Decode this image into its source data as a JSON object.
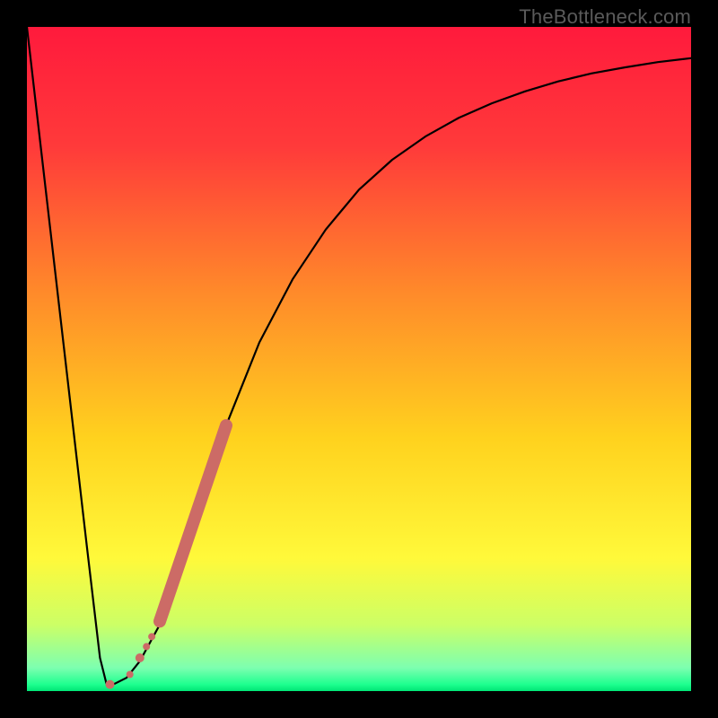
{
  "watermark": "TheBottleneck.com",
  "chart_data": {
    "type": "line",
    "title": "",
    "xlabel": "",
    "ylabel": "",
    "xlim": [
      0,
      100
    ],
    "ylim": [
      0,
      100
    ],
    "gradient_stops": [
      {
        "pos": 0.0,
        "color": "#ff1a3c"
      },
      {
        "pos": 0.18,
        "color": "#ff3a3a"
      },
      {
        "pos": 0.4,
        "color": "#ff8a2a"
      },
      {
        "pos": 0.62,
        "color": "#ffd21e"
      },
      {
        "pos": 0.8,
        "color": "#fff93a"
      },
      {
        "pos": 0.9,
        "color": "#ccff66"
      },
      {
        "pos": 0.965,
        "color": "#7dffb0"
      },
      {
        "pos": 0.99,
        "color": "#1eff8f"
      },
      {
        "pos": 1.0,
        "color": "#00e676"
      }
    ],
    "series": [
      {
        "name": "bottleneck-curve",
        "x": [
          0.0,
          3.0,
          6.0,
          9.0,
          11.0,
          12.0,
          13.0,
          15.0,
          17.0,
          20.0,
          22.0,
          24.0,
          27.0,
          30.0,
          35.0,
          40.0,
          45.0,
          50.0,
          55.0,
          60.0,
          65.0,
          70.0,
          75.0,
          80.0,
          85.0,
          90.0,
          95.0,
          100.0
        ],
        "values": [
          100.0,
          74.0,
          48.0,
          22.0,
          5.0,
          1.0,
          1.0,
          2.0,
          4.5,
          10.0,
          16.0,
          22.0,
          31.0,
          40.0,
          52.5,
          62.0,
          69.5,
          75.5,
          80.0,
          83.5,
          86.3,
          88.5,
          90.3,
          91.8,
          93.0,
          93.9,
          94.7,
          95.3
        ]
      }
    ],
    "highlight_min_x": 12.5,
    "highlight_dots": [
      {
        "x": 15.5,
        "y": 2.5,
        "r": 4
      },
      {
        "x": 17.0,
        "y": 5.0,
        "r": 5
      },
      {
        "x": 18.0,
        "y": 6.7,
        "r": 4
      },
      {
        "x": 18.8,
        "y": 8.2,
        "r": 4
      }
    ],
    "highlight_band": {
      "x0": 20.0,
      "y0": 10.5,
      "x1": 30.0,
      "y1": 40.0,
      "width": 14
    },
    "highlight_color": "#cc6b66"
  }
}
